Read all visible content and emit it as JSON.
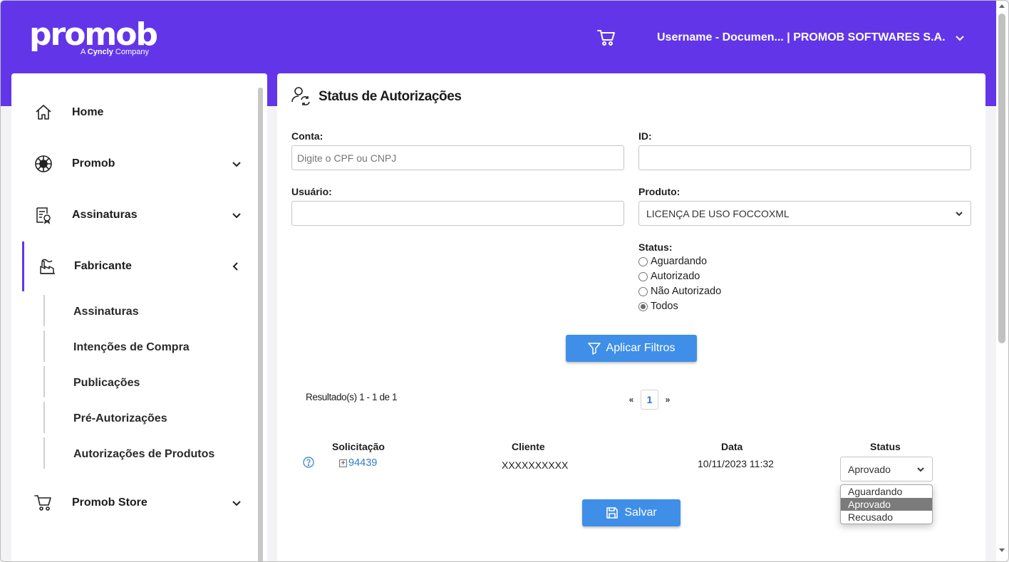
{
  "header": {
    "logo_text": "promob",
    "logo_sub_prefix": "A ",
    "logo_sub_brand": "Cyncly",
    "logo_sub_suffix": " Company",
    "user_label": "Username - Documen... | PROMOB SOFTWARES S.A.",
    "brand_color": "#6236e8"
  },
  "sidebar": {
    "items": [
      {
        "label": "Home",
        "icon": "home-icon"
      },
      {
        "label": "Promob",
        "icon": "promob-icon"
      },
      {
        "label": "Assinaturas",
        "icon": "certificate-icon"
      },
      {
        "label": "Fabricante",
        "icon": "factory-icon"
      },
      {
        "label": "Promob Store",
        "icon": "cart-icon"
      }
    ],
    "sub_items": [
      "Assinaturas",
      "Intenções de Compra",
      "Publicações",
      "Pré-Autorizações",
      "Autorizações de Produtos"
    ]
  },
  "main": {
    "title": "Status de Autorizações",
    "conta_label": "Conta:",
    "conta_placeholder": "Digite o CPF ou CNPJ",
    "id_label": "ID:",
    "usuario_label": "Usuário:",
    "produto_label": "Produto:",
    "produto_value": "LICENÇA DE USO FOCCOXML",
    "status_label": "Status:",
    "status_options": [
      "Aguardando",
      "Autorizado",
      "Não Autorizado",
      "Todos"
    ],
    "status_selected": "Todos",
    "apply_button": "Aplicar Filtros",
    "results_text": "Resultado(s) 1 - 1 de 1",
    "pager": {
      "prev": "«",
      "current": "1",
      "next": "»"
    },
    "table": {
      "headers": [
        "Solicitação",
        "Cliente",
        "Data",
        "Status"
      ],
      "rows": [
        {
          "request": "94439",
          "client": "XXXXXXXXXX",
          "date": "10/11/2023 11:32",
          "status": "Aprovado"
        }
      ]
    },
    "status_dropdown_options": [
      "Aguardando",
      "Aprovado",
      "Recusado"
    ],
    "save_button": "Salvar",
    "button_color": "#3f8fe8"
  }
}
